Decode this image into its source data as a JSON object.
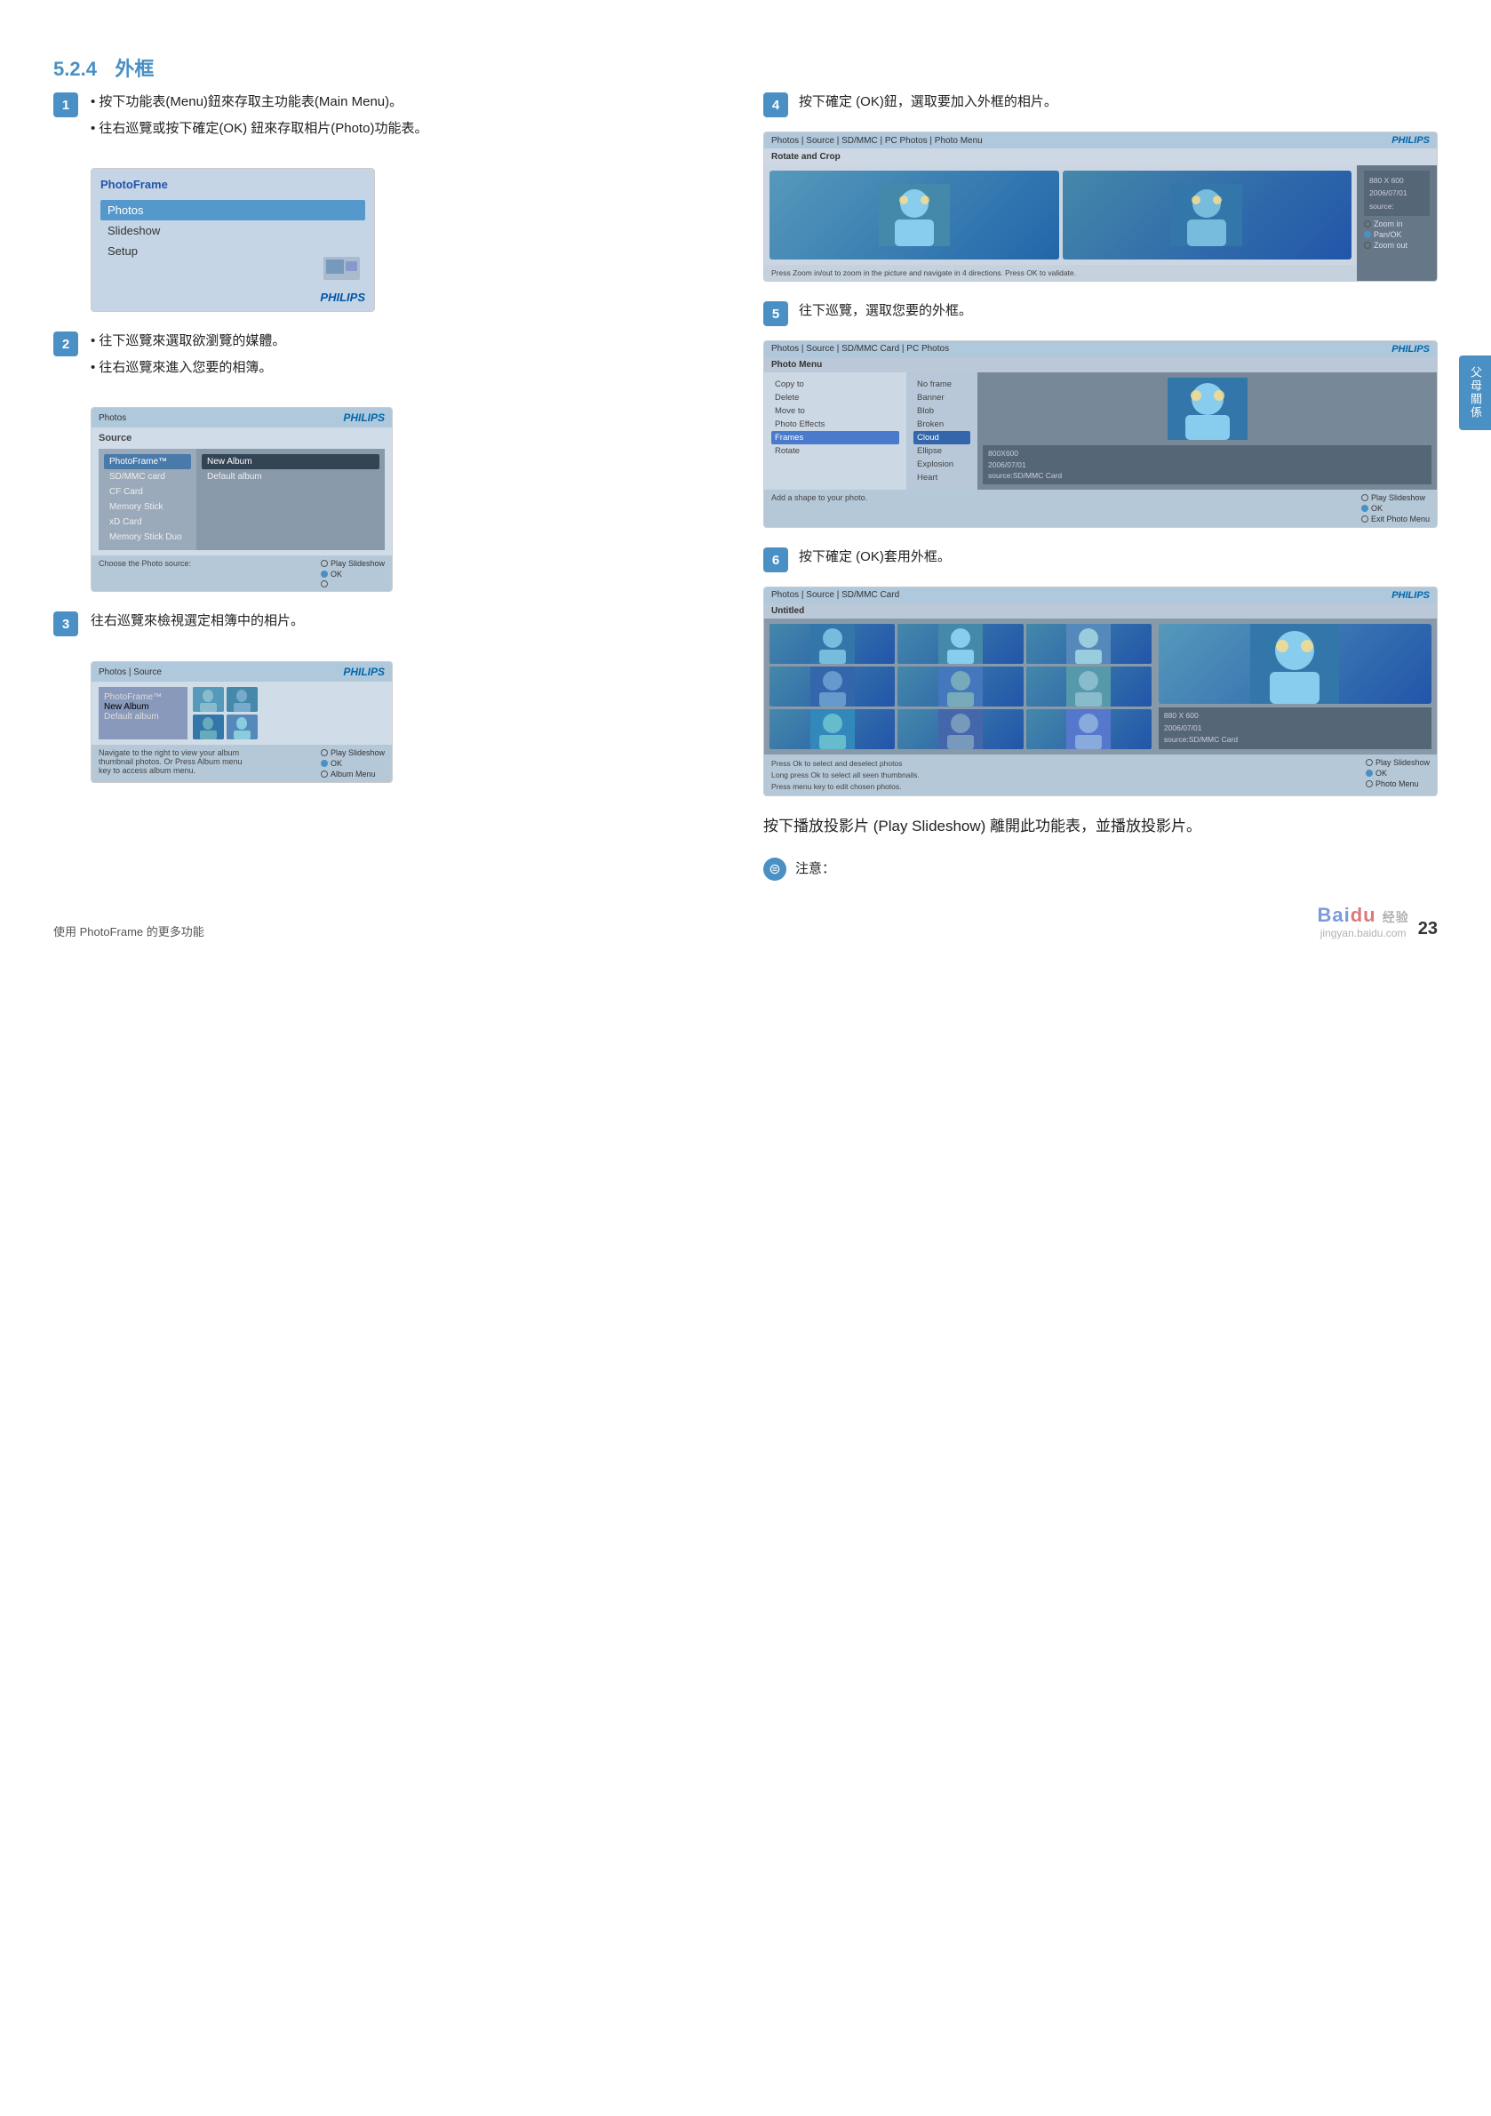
{
  "side_tab": {
    "label": "父母關係"
  },
  "section": {
    "number": "5.2.4",
    "title": "外框"
  },
  "steps_left": [
    {
      "num": "1",
      "lines": [
        "• 按下功能表(Menu)鈕來存取主功能表(Main Menu)。",
        "• 往右巡覽或按下確定(OK) 鈕來存取相片(Photo)功能表。"
      ]
    },
    {
      "num": "2",
      "lines": [
        "• 往下巡覽來選取欲瀏覽的媒體。",
        "• 往右巡覽來進入您要的相簿。"
      ]
    },
    {
      "num": "3",
      "lines": [
        "往右巡覽來檢視選定相簿中的相片。"
      ]
    }
  ],
  "steps_right": [
    {
      "num": "4",
      "text": "按下確定 (OK)鈕，選取要加入外框的相片。"
    },
    {
      "num": "5",
      "text": "往下巡覽，選取您要的外框。"
    },
    {
      "num": "6",
      "text": "按下確定 (OK)套用外框。"
    }
  ],
  "big_text": "按下播放投影片 (Play Slideshow) 離開此功能表，並播放投影片。",
  "note_label": "注意：",
  "screens": {
    "pf_menu": {
      "title": "PhotoFrame",
      "items": [
        "Photos",
        "Slideshow",
        "Setup"
      ],
      "selected": "Photos",
      "philips": "PHILIPS"
    },
    "source": {
      "bar": "Photos",
      "philips": "PHILIPS",
      "title": "Source",
      "left_items": [
        "PhotoFrame™",
        "SD/MMC card",
        "CF Card",
        "Memory Stick",
        "xD Card",
        "Memory Stick Duo"
      ],
      "selected_left": "PhotoFrame™",
      "right_items": [
        "New Album",
        "Default album"
      ],
      "selected_right": "New Album",
      "footer_text": "Choose the Photo source:",
      "btns": [
        "Play Slideshow",
        "OK",
        ""
      ]
    },
    "album": {
      "bar": "Photos | Source",
      "philips": "PHILIPS",
      "album_items": [
        "PhotoFrame™",
        "New Album",
        "Default album"
      ],
      "selected": "Default album",
      "footer_text": "Navigate to the right to view your album thumbnail photos. Or Press Album menu key to access album menu.",
      "btns": [
        "Play Slideshow",
        "OK",
        "Album Menu"
      ]
    },
    "rotate_crop": {
      "bar": "Photos | Source | SD/MMC | PC Photos | Photo Menu",
      "philips": "PHILIPS",
      "title": "Rotate and Crop",
      "caption": "Press Zoom in/out to zoom in the picture and navigate in 4 directions. Press OK to validate.",
      "info": "880 X 600\n2006/07/01\nsource:",
      "btns": [
        "Zoom in",
        "Pan/OK",
        "Zoom out"
      ]
    },
    "photo_menu": {
      "bar": "Photos | Source | SD/MMC Card | PC Photos",
      "philips": "PHILIPS",
      "title": "Photo Menu",
      "menu_items": [
        "Copy to",
        "Delete",
        "Move to",
        "Photo Effects",
        "Frames",
        "Rotate"
      ],
      "selected_menu": "Frames",
      "sub_items": [
        "No frame",
        "Banner",
        "Blob",
        "Broken",
        "Cloud",
        "Ellipse",
        "Explosion",
        "Heart"
      ],
      "selected_sub": "Cloud",
      "info": "800X600\n2006/07/01\nsource:SD/MMC Card",
      "footer_left": "Add a shape to your photo.",
      "btns": [
        "Play Slideshow",
        "OK",
        "Exit Photo Menu"
      ]
    },
    "grid": {
      "bar": "Photos | Source | SD/MMC Card",
      "philips": "PHILIPS",
      "title": "Untitled",
      "info": "880 X 600\n2006/07/01\nsource:SD/MMC Card",
      "footer_text": "Press Ok to select and deselect photos\nLong press Ok to select all seen thumbnails.\nPress menu key to edit chosen photos.",
      "btns": [
        "Play Slideshow",
        "OK",
        "Photo Menu"
      ]
    }
  },
  "footer": {
    "left_text": "使用 PhotoFrame 的更多功能",
    "page_num": "23",
    "baidu": "Bai du 经验",
    "baidu_url": "jingyan.baidu.com"
  }
}
